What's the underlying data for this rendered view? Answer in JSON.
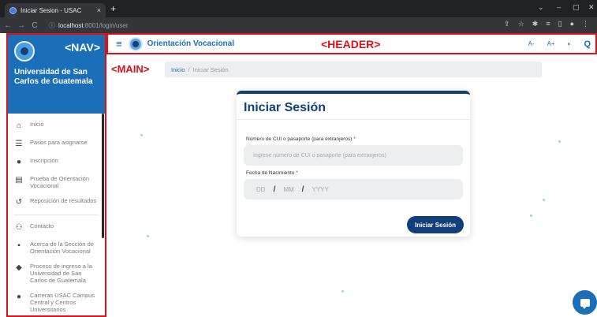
{
  "browser": {
    "tab_title": "Iniciar Sesion - USAC",
    "tab_close": "×",
    "new_tab": "+",
    "url_host": "localhost",
    "url_path": ":8001/login/user",
    "nav": {
      "back": "←",
      "forward": "→",
      "reload": "C"
    },
    "window": {
      "collapse": "⌄",
      "minimize": "–",
      "maximize": "▢",
      "close": "✕"
    },
    "toolbar_icons": [
      "⇪",
      "☆",
      "✱",
      "≡",
      "▯",
      "●",
      "⋮"
    ]
  },
  "sidebar": {
    "tag": "<NAV>",
    "university": "Universidad de San Carlos de Guatemala",
    "items": [
      {
        "label": "Inicio",
        "icon": "⌂",
        "icon_name": "home-icon"
      },
      {
        "label": "Pasos para asignarse",
        "icon": "☰",
        "icon_name": "list-icon"
      },
      {
        "label": "Inscripción",
        "icon": "●",
        "icon_name": "info-icon"
      },
      {
        "label": "Prueba de Orientación Vocacional",
        "icon": "▤",
        "icon_name": "clipboard-icon"
      },
      {
        "label": "Reposición de resultados",
        "icon": "↺",
        "icon_name": "history-icon"
      },
      {
        "label": "Contacto",
        "icon": "⚇",
        "icon_name": "people-icon"
      },
      {
        "label": "Acerca de la Sección de Orientación Vocacional",
        "icon": "▪",
        "icon_name": "comment-icon"
      },
      {
        "label": "Proceso de ingreso a la Universidad de San Carlos de Guatemala",
        "icon": "◆",
        "icon_name": "graduation-cap-icon"
      },
      {
        "label": "Carreras USAC Campus Central y Centros Universitarios",
        "icon": "●",
        "icon_name": "info-icon"
      }
    ]
  },
  "header": {
    "menu_icon": "≡",
    "title": "Orientación Vocacional",
    "tag": "<HEADER>",
    "tools": [
      "A-",
      "A+",
      "◐",
      "Q"
    ]
  },
  "main": {
    "tag": "<MAIN>",
    "breadcrumb": {
      "home": "Inicio",
      "separator": "/",
      "current": "Iniciar Sesión"
    }
  },
  "login": {
    "title": "Iniciar Sesión",
    "cui_label": "Número de CUI o pasaporte (para extranjeros)",
    "cui_placeholder": "Ingrese número de CUI o pasaporte (para extranjeros)",
    "required_mark": "*",
    "dob_label": "Fecha de Nacimiento",
    "dob_day": "DD",
    "dob_month": "MM",
    "dob_year": "YYYY",
    "dob_separator": "/",
    "submit": "Iniciar Sesión"
  },
  "colors": {
    "primary": "#1b6fb8",
    "dark_blue": "#123e7a",
    "annotation_red": "#e0101a",
    "input_bg": "#eceef0"
  }
}
